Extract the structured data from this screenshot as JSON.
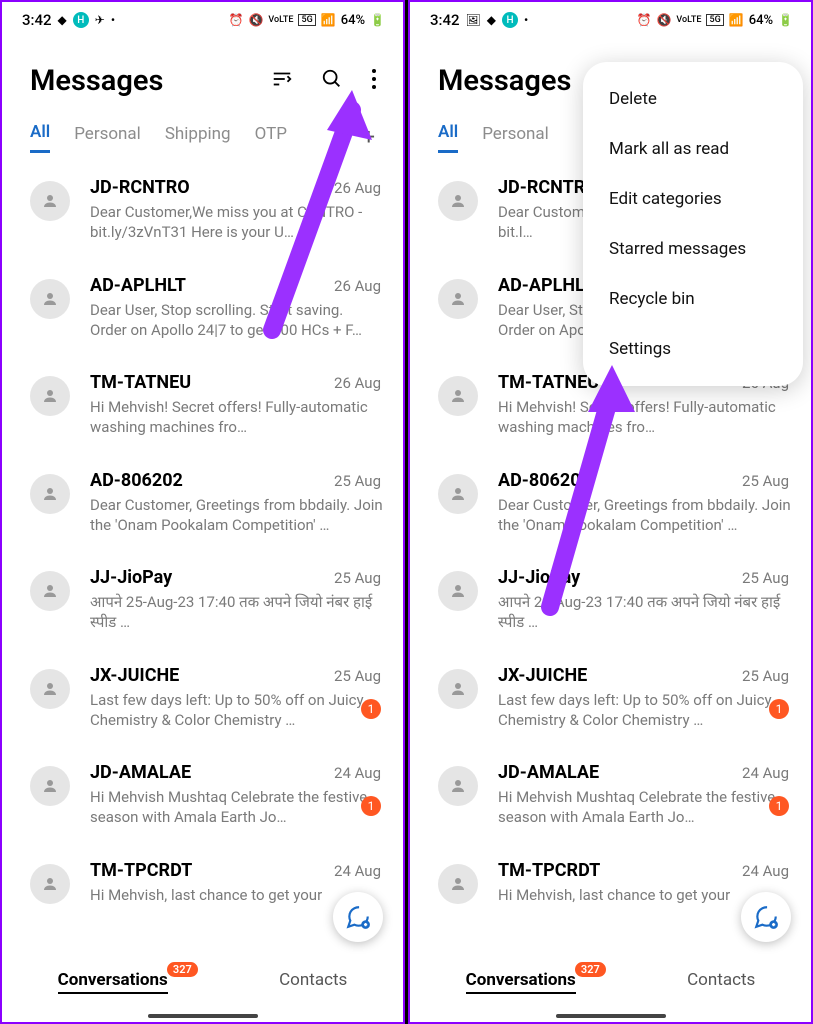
{
  "status": {
    "time": "3:42",
    "battery_pct": "64%",
    "network_label": "5G"
  },
  "header": {
    "title": "Messages"
  },
  "tabs": {
    "items": [
      "All",
      "Personal",
      "Shipping",
      "OTP"
    ],
    "active_index": 0
  },
  "messages": [
    {
      "sender": "JD-RCNTRO",
      "date": "26 Aug",
      "preview": "Dear Customer,We miss you at CENTRO - bit.ly/3zVnT31 Here is your U…",
      "preview_short": "Dear Customer,We miss you at CENTRO - bit.l…",
      "unread": 0
    },
    {
      "sender": "AD-APLHLT",
      "date": "26 Aug",
      "preview": "Dear User,  Stop scrolling. Start saving. Order on Apollo 24|7 to get 300 HCs + F…",
      "preview_short": "Dear User,  Stop scrolling. Start saving. Order on Apollo 24|7 to get 300 HCs + F…",
      "unread": 0
    },
    {
      "sender": "TM-TATNEU",
      "date": "26 Aug",
      "preview": "Hi Mehvish! Secret offers! Fully-automatic washing machines fro…",
      "unread": 0
    },
    {
      "sender": "AD-806202",
      "date": "25 Aug",
      "preview": "Dear Customer, Greetings from bbdaily. Join the 'Onam Pookalam Competition' …",
      "unread": 0
    },
    {
      "sender": "JJ-JioPay",
      "date": "25 Aug",
      "preview": "आपने 25-Aug-23 17:40 तक अपने जियो नंबर                                     हाई स्पीड …",
      "unread": 0
    },
    {
      "sender": "JX-JUICHE",
      "date": "25 Aug",
      "preview": "Last few days left: Up to 50% off on Juicy Chemistry & Color Chemistry …",
      "unread": 1
    },
    {
      "sender": "JD-AMALAE",
      "date": "24 Aug",
      "preview": "Hi Mehvish Mushtaq Celebrate the festive season with Amala Earth Jo…",
      "unread": 1
    },
    {
      "sender": "TM-TPCRDT",
      "date": "24 Aug",
      "preview": "Hi Mehvish, last chance to get your",
      "unread": 0
    }
  ],
  "menu": {
    "items": [
      "Delete",
      "Mark all as read",
      "Edit categories",
      "Starred messages",
      "Recycle bin",
      "Settings"
    ]
  },
  "bottom": {
    "conversations": "Conversations",
    "contacts": "Contacts",
    "badge": "327"
  }
}
